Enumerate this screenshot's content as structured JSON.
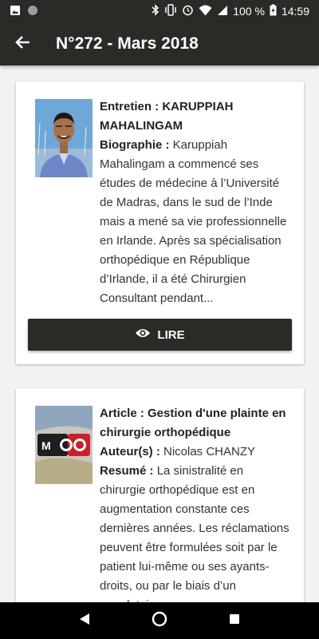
{
  "status_bar": {
    "battery_percent": "100 %",
    "time": "14:59"
  },
  "app_bar": {
    "title": "N°272 - Mars 2018"
  },
  "cards": [
    {
      "heading_prefix": "Entretien : ",
      "heading_name": "KARUPPIAH MAHALINGAM",
      "body_label": "Biographie : ",
      "body_text": "Karuppiah Mahalingam a commencé ses études de médecine à l’Université de Madras, dans le sud de l’Inde mais a mené sa vie professionnelle en Irlande. Après sa spécialisation orthopédique en République d’Irlande, il a été Chirurgien Consultant pendant...",
      "button_label": "LIRE"
    },
    {
      "heading_prefix": "Article : ",
      "heading_name": "Gestion d'une plainte en chirurgie orthopédique",
      "author_label": "Auteur(s) : ",
      "author_value": "Nicolas CHANZY",
      "body_label": "Resumé : ",
      "body_text": "La sinistralité en chirurgie orthopédique est en augmentation constante ces dernières années. Les réclamations peuvent être formulées soit par le patient lui-même ou ses ayants-droits, ou par le biais d’un mandataire.",
      "logo_text": "MOO"
    }
  ]
}
